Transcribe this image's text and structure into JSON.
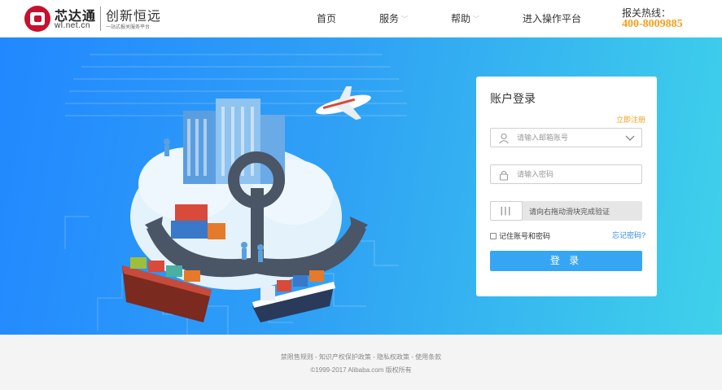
{
  "header": {
    "logo_name": "芯达通",
    "logo_domain": "wl.net.cn",
    "logo_slogan": "创新恒远",
    "logo_sub": "一站式报关服务平台",
    "nav": {
      "home": "首页",
      "services": "服务",
      "help": "帮助",
      "platform": "进入操作平台"
    },
    "hotline_label": "报关热线：",
    "hotline_number": "400-8009885"
  },
  "login": {
    "title": "账户登录",
    "register_link": "立即注册",
    "account_placeholder": "请输入邮箱账号",
    "password_placeholder": "请输入密码",
    "slider_handle": "|||",
    "slider_text": "请向右拖动滑块完成验证",
    "remember_label": "记住账号和密码",
    "forgot_link": "忘记密码?",
    "submit_label": "登 录"
  },
  "footer": {
    "link_sales": "禁限售规则",
    "sep1": " - ",
    "link_ip": "知识产权保护政策",
    "sep2": " - ",
    "link_privacy": "隐私权政策",
    "sep3": " - ",
    "link_terms": "使用条款",
    "copyright": "©1999-2017 Alibaba.com 版权所有"
  },
  "colors": {
    "brand_red": "#c8102e",
    "hotline_orange": "#f5a01a",
    "banner_start": "#2288ff",
    "banner_end": "#3fd2ea",
    "button_blue": "#36a6f4",
    "link_blue": "#2a8be8",
    "register_orange": "#f0a020"
  },
  "icons": {
    "user": "user-icon",
    "lock": "lock-icon",
    "dropdown": "chevron-down-icon"
  }
}
